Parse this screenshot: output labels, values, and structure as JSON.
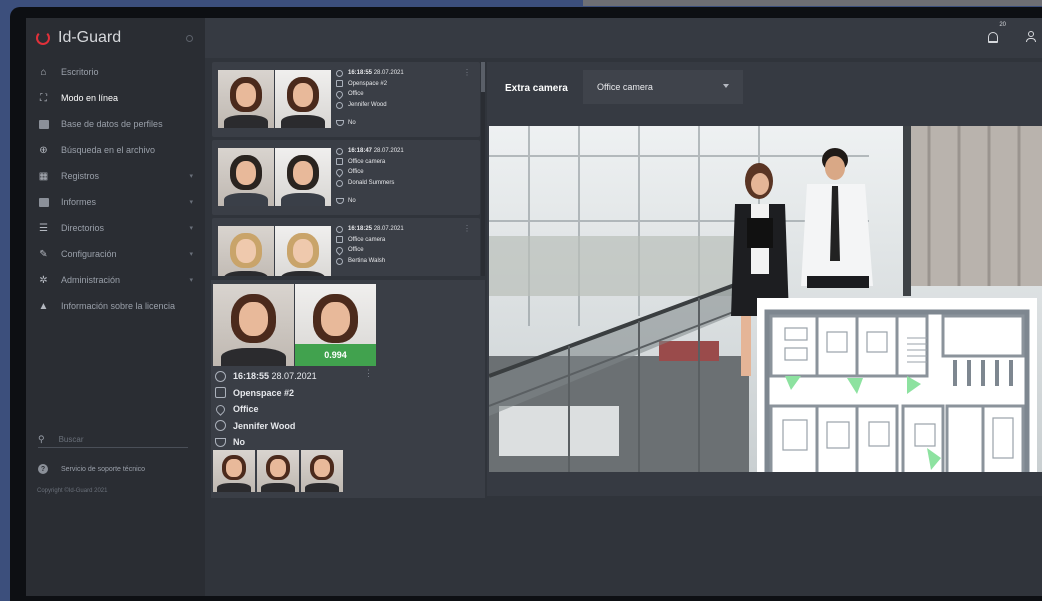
{
  "app": {
    "name": "Id-Guard"
  },
  "sidebar": {
    "items": [
      {
        "label": "Escritorio",
        "icon": "home-icon",
        "active": false,
        "has_arrow": false
      },
      {
        "label": "Modo en línea",
        "icon": "live-view-icon",
        "active": true,
        "has_arrow": false
      },
      {
        "label": "Base de datos de perfiles",
        "icon": "profile-card-icon",
        "active": false,
        "has_arrow": false
      },
      {
        "label": "Búsqueda en el archivo",
        "icon": "search-archive-icon",
        "active": false,
        "has_arrow": false
      },
      {
        "label": "Registros",
        "icon": "table-icon",
        "active": false,
        "has_arrow": true
      },
      {
        "label": "Informes",
        "icon": "report-icon",
        "active": false,
        "has_arrow": true
      },
      {
        "label": "Directorios",
        "icon": "list-icon",
        "active": false,
        "has_arrow": true
      },
      {
        "label": "Configuración",
        "icon": "wrench-icon",
        "active": false,
        "has_arrow": true
      },
      {
        "label": "Administración",
        "icon": "gear-icon",
        "active": false,
        "has_arrow": true
      },
      {
        "label": "Información sobre la licencia",
        "icon": "license-icon",
        "active": false,
        "has_arrow": false
      }
    ],
    "search_placeholder": "Buscar",
    "support_label": "Servicio de soporte técnico",
    "copyright": "Copyright ©Id-Guard 2021"
  },
  "topbar": {
    "notifications_count": "20",
    "bell_icon": "bell-icon",
    "user_icon": "user-icon"
  },
  "events": [
    {
      "time": "16:18:55",
      "date": "28.07.2021",
      "camera": "Openspace #2",
      "location": "Office",
      "person": "Jennifer Wood",
      "mask": "No"
    },
    {
      "time": "16:18:47",
      "date": "28.07.2021",
      "camera": "Office camera",
      "location": "Office",
      "person": "Donald Summers",
      "mask": "No"
    },
    {
      "time": "16:18:25",
      "date": "28.07.2021",
      "camera": "Office camera",
      "location": "Office",
      "person": "Bertina Walsh",
      "mask": ""
    }
  ],
  "detail": {
    "score": "0.994",
    "time": "16:18:55",
    "date": "28.07.2021",
    "camera": "Openspace #2",
    "location": "Office",
    "person": "Jennifer Wood",
    "mask": "No"
  },
  "camera_panel": {
    "label": "Extra camera",
    "selected": "Office camera"
  },
  "colors": {
    "accent_red": "#e0303a",
    "match_green": "#41a24e",
    "sidebar_bg": "#2a2d33",
    "panel_bg": "#363a42"
  }
}
